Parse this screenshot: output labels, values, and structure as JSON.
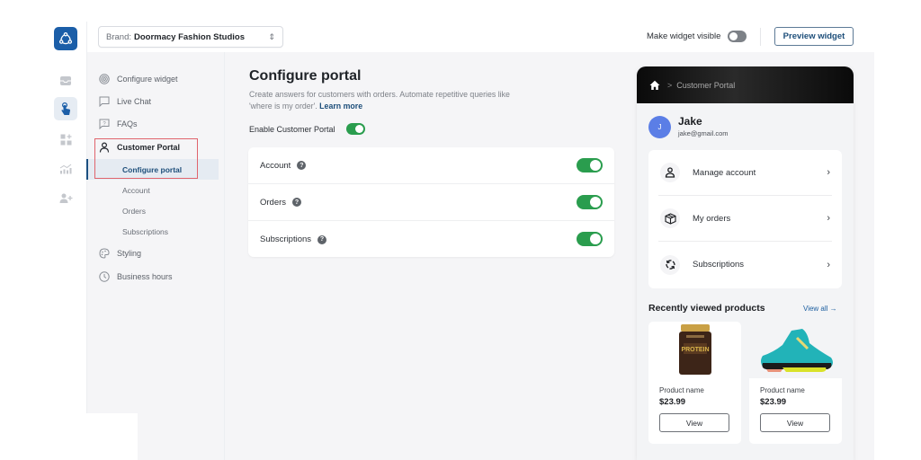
{
  "topbar": {
    "brand_label": "Brand:",
    "brand_value": "Doormacy Fashion Studios",
    "widget_visible_label": "Make widget visible",
    "widget_visible": false,
    "preview_button": "Preview widget"
  },
  "rail": {
    "items": [
      {
        "icon": "inbox-icon",
        "active": false
      },
      {
        "icon": "tap-hand-icon",
        "active": true
      },
      {
        "icon": "apps-add-icon",
        "active": false
      },
      {
        "icon": "analytics-icon",
        "active": false
      },
      {
        "icon": "users-add-icon",
        "active": false
      }
    ]
  },
  "subnav": {
    "items": [
      {
        "label": "Configure widget",
        "icon": "target-icon"
      },
      {
        "label": "Live Chat",
        "icon": "chat-icon"
      },
      {
        "label": "FAQs",
        "icon": "faq-icon"
      },
      {
        "label": "Customer Portal",
        "icon": "user-icon"
      },
      {
        "label": "Styling",
        "icon": "palette-icon"
      },
      {
        "label": "Business hours",
        "icon": "clock-icon"
      }
    ],
    "portal_children": [
      {
        "label": "Configure portal",
        "active": true
      },
      {
        "label": "Account",
        "active": false
      },
      {
        "label": "Orders",
        "active": false
      },
      {
        "label": "Subscriptions",
        "active": false
      }
    ]
  },
  "main": {
    "title": "Configure portal",
    "description": "Create answers for customers with orders. Automate repetitive queries like 'where is my order'.",
    "learn_more": "Learn more",
    "enable_label": "Enable Customer Portal",
    "enable_value": true,
    "settings": [
      {
        "label": "Account",
        "enabled": true
      },
      {
        "label": "Orders",
        "enabled": true
      },
      {
        "label": "Subscriptions",
        "enabled": true
      }
    ],
    "help_glyph": "?"
  },
  "preview": {
    "breadcrumb_sep": ">",
    "breadcrumb": "Customer Portal",
    "user": {
      "initial": "J",
      "name": "Jake",
      "email": "jake@gmail.com"
    },
    "menu": [
      {
        "label": "Manage account",
        "icon": "user-icon"
      },
      {
        "label": "My orders",
        "icon": "package-icon"
      },
      {
        "label": "Subscriptions",
        "icon": "refresh-icon"
      }
    ],
    "chevron": "›",
    "recent_title": "Recently viewed products",
    "view_all": "View all →",
    "products": [
      {
        "name": "Product name",
        "price": "$23.99",
        "button": "View",
        "image": "protein-jar"
      },
      {
        "name": "Product name",
        "price": "$23.99",
        "button": "View",
        "image": "sneaker"
      }
    ]
  },
  "colors": {
    "brand": "#1b5ea8",
    "accent": "#1d4e7a",
    "toggle_on": "#2a9d4e",
    "highlight": "#e0646d"
  }
}
